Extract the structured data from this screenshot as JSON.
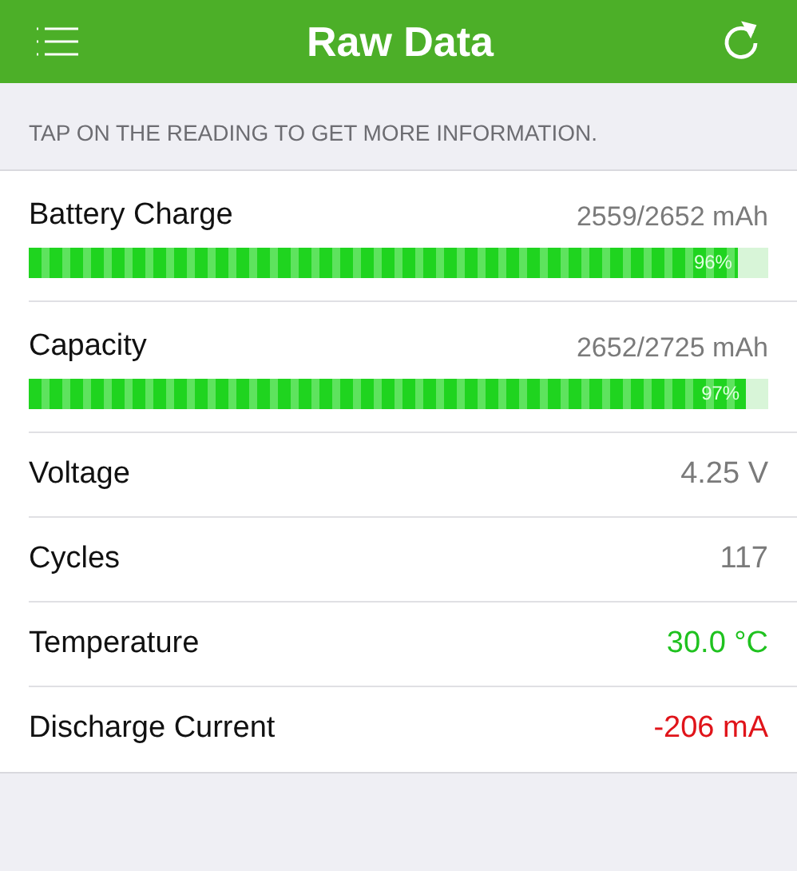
{
  "header": {
    "title": "Raw Data"
  },
  "hint": "TAP ON THE READING TO GET MORE INFORMATION.",
  "rows": [
    {
      "kind": "bar",
      "label": "Battery Charge",
      "value": "2559/2652 mAh",
      "level": 0.96,
      "percent": "96%"
    },
    {
      "kind": "bar",
      "label": "Capacity",
      "value": "2652/2725 mAh",
      "level": 0.97,
      "percent": "97%"
    },
    {
      "kind": "plain",
      "label": "Voltage",
      "value": "4.25 V",
      "color": "#7a7a7a"
    },
    {
      "kind": "plain",
      "label": "Cycles",
      "value": "117",
      "color": "#7a7a7a"
    },
    {
      "kind": "plain",
      "label": "Temperature",
      "value": "30.0 °C",
      "color": "#1fc21f"
    },
    {
      "kind": "plain",
      "label": "Discharge Current",
      "value": "-206 mA",
      "color": "#e0141a"
    }
  ]
}
